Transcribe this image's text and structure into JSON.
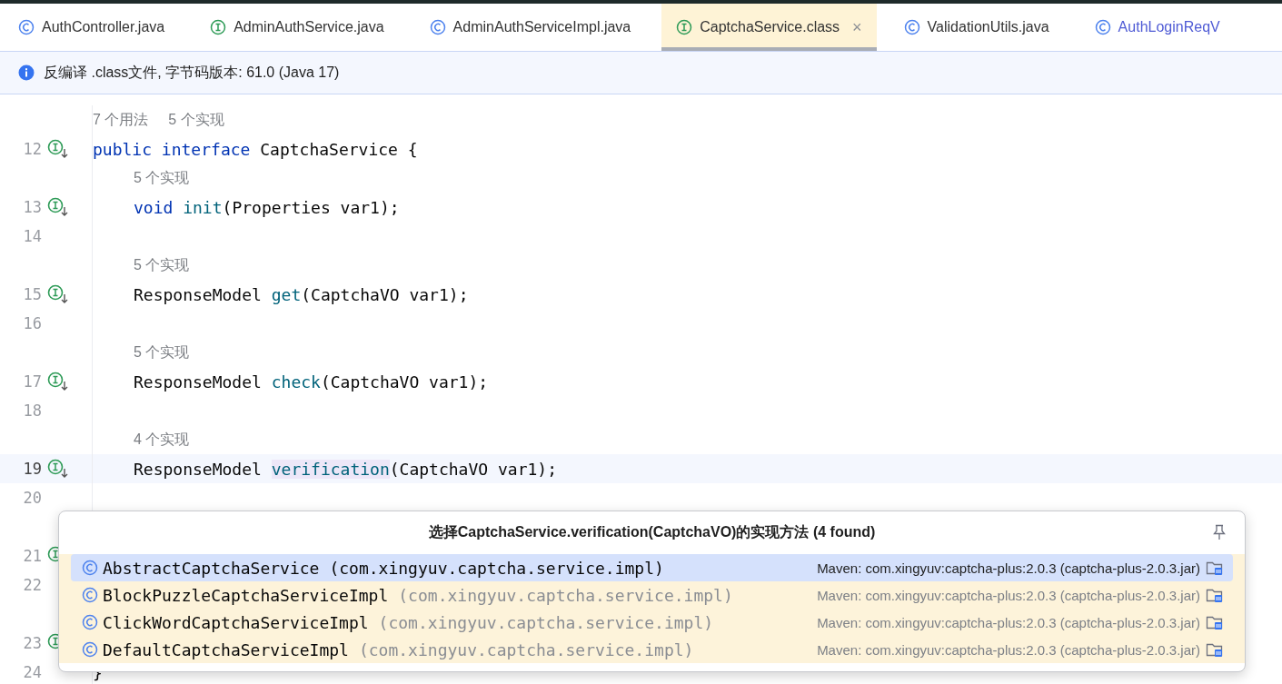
{
  "tabs": [
    {
      "label": "AuthController.java",
      "kind": "class",
      "selected": false,
      "modified": false
    },
    {
      "label": "AdminAuthService.java",
      "kind": "interface",
      "selected": false,
      "modified": false
    },
    {
      "label": "AdminAuthServiceImpl.java",
      "kind": "class",
      "selected": false,
      "modified": false
    },
    {
      "label": "CaptchaService.class",
      "kind": "interface",
      "selected": true,
      "modified": false,
      "close": "×"
    },
    {
      "label": "ValidationUtils.java",
      "kind": "class",
      "selected": false,
      "modified": false
    },
    {
      "label": "AuthLoginReqV",
      "kind": "class",
      "selected": false,
      "modified": true
    }
  ],
  "banner": {
    "text": "反编译 .class文件, 字节码版本: 61.0 (Java 17)"
  },
  "editor": {
    "lines": [
      {
        "kind": "hint",
        "hints": [
          "7 个用法",
          "5 个实现"
        ]
      },
      {
        "kind": "code",
        "number": "12",
        "marker": true,
        "current": false,
        "tokens": [
          {
            "text": "public ",
            "kind": "keyword"
          },
          {
            "text": "interface ",
            "kind": "keyword"
          },
          {
            "text": "CaptchaService {",
            "kind": "plain"
          }
        ],
        "children": [
          {
            "kind": "hint",
            "hints": [
              "5 个实现"
            ]
          },
          {
            "kind": "code",
            "number": "13",
            "marker": true,
            "current": false,
            "tokens": [
              {
                "text": "void ",
                "kind": "keyword"
              },
              {
                "text": "init",
                "kind": "method"
              },
              {
                "text": "(Properties var1);",
                "kind": "plain"
              }
            ]
          },
          {
            "kind": "code",
            "number": "14",
            "marker": false,
            "current": false
          },
          {
            "kind": "hint",
            "hints": [
              "5 个实现"
            ]
          },
          {
            "kind": "code",
            "number": "15",
            "marker": true,
            "current": false,
            "tokens": [
              {
                "text": "ResponseModel ",
                "kind": "plain"
              },
              {
                "text": "get",
                "kind": "method"
              },
              {
                "text": "(CaptchaVO var1);",
                "kind": "plain"
              }
            ]
          },
          {
            "kind": "code",
            "number": "16",
            "marker": false,
            "current": false
          },
          {
            "kind": "hint",
            "hints": [
              "5 个实现"
            ]
          },
          {
            "kind": "code",
            "number": "17",
            "marker": true,
            "current": false,
            "tokens": [
              {
                "text": "ResponseModel ",
                "kind": "plain"
              },
              {
                "text": "check",
                "kind": "method"
              },
              {
                "text": "(CaptchaVO var1);",
                "kind": "plain"
              }
            ]
          },
          {
            "kind": "code",
            "number": "18",
            "marker": false,
            "current": false
          },
          {
            "kind": "hint",
            "hints": [
              "4 个实现"
            ]
          },
          {
            "kind": "code",
            "number": "19",
            "marker": true,
            "current": true,
            "tokens": [
              {
                "text": "ResponseModel ",
                "kind": "plain"
              },
              {
                "text": "verification",
                "kind": "method",
                "highlighted": true
              },
              {
                "text": "(CaptchaVO var1);",
                "kind": "plain"
              }
            ]
          },
          {
            "kind": "code",
            "number": "20",
            "marker": false,
            "current": false
          },
          {
            "kind": "hint"
          },
          {
            "kind": "code",
            "number": "21",
            "marker": true,
            "current": false
          },
          {
            "kind": "code",
            "number": "22",
            "marker": false,
            "current": false
          },
          {
            "kind": "hint"
          },
          {
            "kind": "code",
            "number": "23",
            "marker": true,
            "current": false
          }
        ]
      },
      {
        "kind": "code",
        "number": "24",
        "marker": false,
        "current": false,
        "tokens": [
          {
            "text": "}",
            "kind": "plain"
          }
        ]
      }
    ]
  },
  "popup": {
    "title": "选择CaptchaService.verification(CaptchaVO)的实现方法 (4 found)",
    "items": [
      {
        "name": "AbstractCaptchaService",
        "package": "(com.xingyuv.captcha.service.impl)",
        "location": "Maven: com.xingyuv:captcha-plus:2.0.3 (captcha-plus-2.0.3.jar)",
        "selected": true
      },
      {
        "name": "BlockPuzzleCaptchaServiceImpl",
        "package": "(com.xingyuv.captcha.service.impl)",
        "location": "Maven: com.xingyuv:captcha-plus:2.0.3 (captcha-plus-2.0.3.jar)",
        "selected": false
      },
      {
        "name": "ClickWordCaptchaServiceImpl",
        "package": "(com.xingyuv.captcha.service.impl)",
        "location": "Maven: com.xingyuv:captcha-plus:2.0.3 (captcha-plus-2.0.3.jar)",
        "selected": false
      },
      {
        "name": "DefaultCaptchaServiceImpl",
        "package": "(com.xingyuv.captcha.service.impl)",
        "location": "Maven: com.xingyuv:captcha-plus:2.0.3 (captcha-plus-2.0.3.jar)",
        "selected": false
      }
    ]
  }
}
